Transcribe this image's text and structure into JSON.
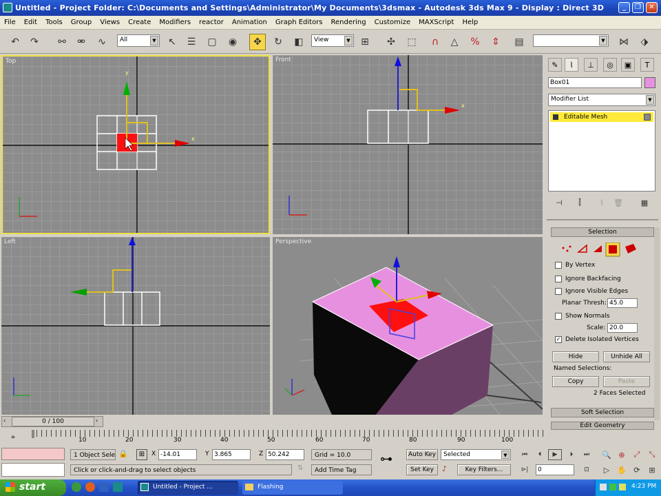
{
  "window": {
    "title": "Untitled    - Project Folder: C:\\Documents and Settings\\Administrator\\My Documents\\3dsmax    - Autodesk 3ds Max 9    - Display : Direct 3D"
  },
  "menu": [
    "File",
    "Edit",
    "Tools",
    "Group",
    "Views",
    "Create",
    "Modifiers",
    "reactor",
    "Animation",
    "Graph Editors",
    "Rendering",
    "Customize",
    "MAXScript",
    "Help"
  ],
  "toolbar": {
    "selection_filter": "All",
    "reference_coord": "View"
  },
  "viewports": {
    "top": "Top",
    "front": "Front",
    "left": "Left",
    "perspective": "Perspective"
  },
  "command_panel": {
    "object_name": "Box01",
    "object_color": "#e890e0",
    "modifier_list": "Modifier List",
    "stack_item": "Editable Mesh",
    "selection": {
      "header": "Selection",
      "by_vertex": "By Vertex",
      "ignore_backfacing": "Ignore Backfacing",
      "ignore_visible_edges": "Ignore Visible Edges",
      "planar_thresh_label": "Planar Thresh:",
      "planar_thresh_value": "45.0",
      "show_normals": "Show Normals",
      "scale_label": "Scale:",
      "scale_value": "20.0",
      "delete_isolated": "Delete Isolated Vertices",
      "hide": "Hide",
      "unhide_all": "Unhide All",
      "named_selections": "Named Selections:",
      "copy": "Copy",
      "paste": "Paste",
      "status": "2 Faces Selected"
    },
    "soft_selection": "Soft Selection",
    "edit_geometry": "Edit Geometry"
  },
  "timeline": {
    "slider_label": "0 / 100",
    "ticks": [
      "10",
      "20",
      "30",
      "40",
      "50",
      "60",
      "70",
      "80",
      "90",
      "100"
    ]
  },
  "status": {
    "selection": "1 Object Sele",
    "x_label": "X",
    "x_value": "-14.01",
    "y_label": "Y",
    "y_value": "3.865",
    "z_label": "Z",
    "z_value": "50.242",
    "grid": "Grid = 10.0",
    "prompt": "Click or click-and-drag to select objects",
    "add_time_tag": "Add Time Tag",
    "auto_key": "Auto Key",
    "selected": "Selected",
    "set_key": "Set Key",
    "key_filters": "Key Filters...",
    "frame": "0"
  },
  "taskbar": {
    "start": "start",
    "tasks": [
      "Untitled    - Project ...",
      "Flashing"
    ],
    "clock": "4:23 PM"
  }
}
